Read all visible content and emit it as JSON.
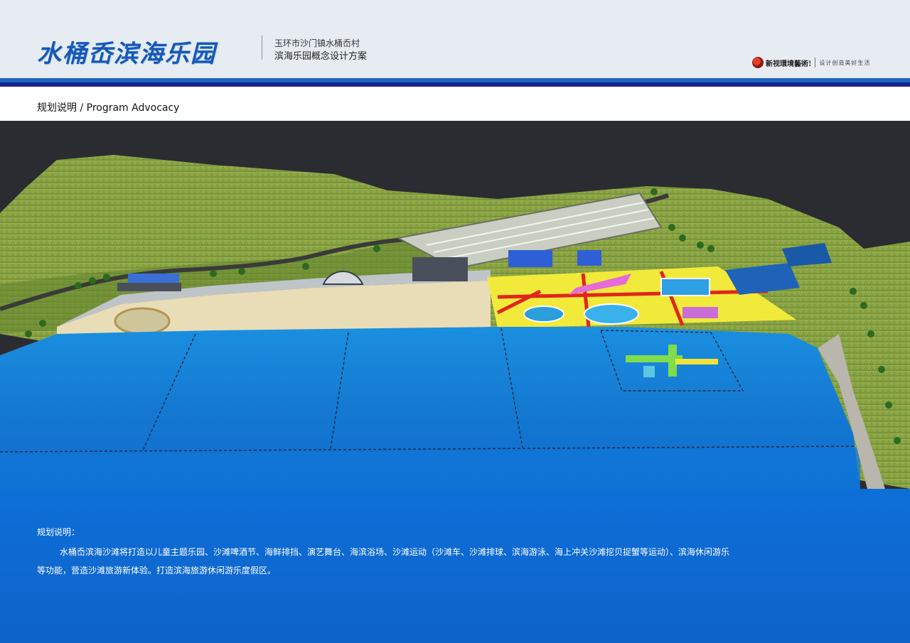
{
  "header": {
    "title": "水桶岙滨海乐园",
    "location": "玉环市沙门镇水桶岙村",
    "plan_name": "滨海乐园概念设计方案",
    "brand_name": "新视環境藝術!",
    "brand_slogan": "设计创造美好生活"
  },
  "section": {
    "title": "规划说明 / Program Advocacy"
  },
  "description": {
    "heading": "规划说明：",
    "body": "水桶岙滨海沙滩将打造以儿童主题乐园、沙滩啤酒节、海鲜排挡、演艺舞台、海滨浴场、沙滩运动（沙滩车、沙滩排球、滨海游泳、海上冲关沙滩挖贝捉蟹等运动）、滨海休闲游乐等功能，营造沙滩旅游新体验。打造滨海旅游休闲游乐度假区。"
  },
  "colors": {
    "title_blue": "#1558b8",
    "rule_blue": "#1d64c2",
    "rule_navy": "#16258a",
    "panel_blue": "#0d6fd8",
    "scene_background": "#2a2c31"
  }
}
